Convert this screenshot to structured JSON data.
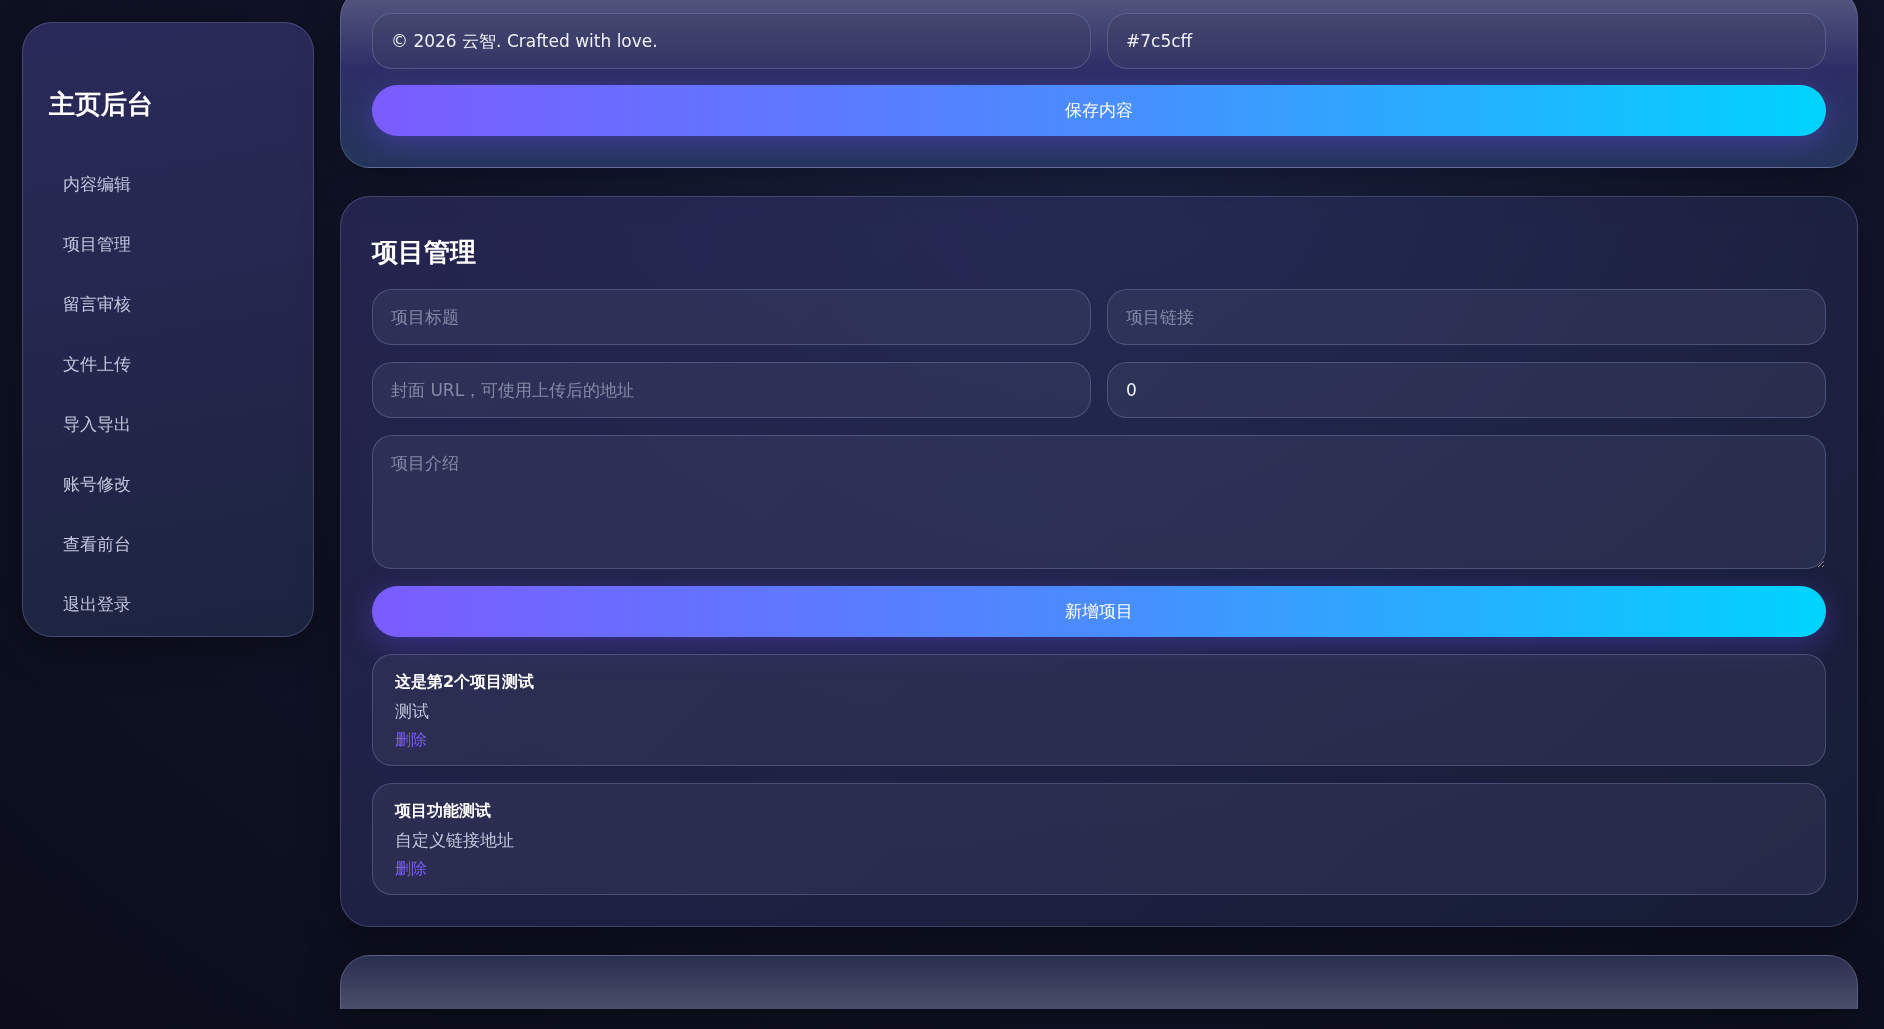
{
  "sidebar": {
    "title": "主页后台",
    "items": [
      {
        "label": "内容编辑"
      },
      {
        "label": "项目管理"
      },
      {
        "label": "留言审核"
      },
      {
        "label": "文件上传"
      },
      {
        "label": "导入导出"
      },
      {
        "label": "账号修改"
      },
      {
        "label": "查看前台"
      },
      {
        "label": "退出登录"
      }
    ]
  },
  "content_panel": {
    "fields": [
      {
        "value": "© 2026 云智. Crafted with love."
      },
      {
        "value": "#7c5cff"
      }
    ],
    "save_button": "保存内容"
  },
  "project_panel": {
    "title": "项目管理",
    "fields": [
      {
        "placeholder": "项目标题"
      },
      {
        "placeholder": "项目链接"
      },
      {
        "placeholder": "封面 URL，可使用上传后的地址"
      },
      {
        "value": "0"
      }
    ],
    "description": {
      "placeholder": "项目介绍"
    },
    "add_button": "新增项目",
    "projects": [
      {
        "title": "这是第2个项目测试",
        "description": "测试",
        "delete_link": "删除"
      },
      {
        "title": "项目功能测试",
        "description": "自定义链接地址",
        "delete_link": "删除"
      }
    ]
  }
}
